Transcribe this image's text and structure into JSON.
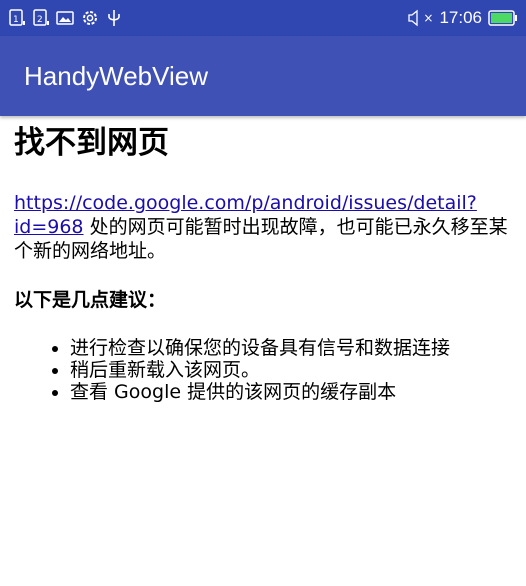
{
  "status_bar": {
    "left_icons": [
      "sim1-icon",
      "sim2-icon",
      "image-icon",
      "settings-icon",
      "usb-icon"
    ],
    "mute_icon": "×",
    "time": "17:06",
    "battery_color": "#4cd964"
  },
  "app_bar": {
    "title": "HandyWebView",
    "color": "#3f51b5"
  },
  "page": {
    "heading": "找不到网页",
    "url": "https://code.google.com/p/android/issues/detail?id=968",
    "desc_rest": " 处的网页可能暂时出现故障，也可能已永久移至某个新的网络地址。",
    "suggest_title": "以下是几点建议：",
    "suggestions": [
      "进行检查以确保您的设备具有信号和数据连接",
      "稍后重新载入该网页。",
      "查看 Google 提供的该网页的缓存副本"
    ]
  }
}
